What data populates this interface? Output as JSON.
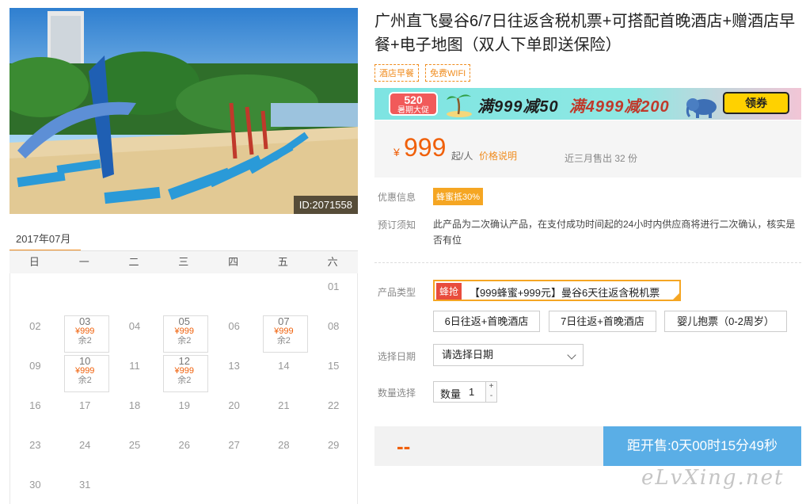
{
  "photo": {
    "id_label": "ID:2071558"
  },
  "calendar": {
    "month": "2017年07月",
    "weekdays": [
      "日",
      "一",
      "二",
      "三",
      "四",
      "五",
      "六"
    ],
    "lead_blanks": 6,
    "days": [
      {
        "d": "01"
      },
      {
        "d": "02"
      },
      {
        "d": "03",
        "price": "¥999",
        "remain": "余2"
      },
      {
        "d": "04"
      },
      {
        "d": "05",
        "price": "¥999",
        "remain": "余2"
      },
      {
        "d": "06"
      },
      {
        "d": "07",
        "price": "¥999",
        "remain": "余2"
      },
      {
        "d": "08"
      },
      {
        "d": "09"
      },
      {
        "d": "10",
        "price": "¥999",
        "remain": "余2"
      },
      {
        "d": "11"
      },
      {
        "d": "12",
        "price": "¥999",
        "remain": "余2"
      },
      {
        "d": "13"
      },
      {
        "d": "14"
      },
      {
        "d": "15"
      },
      {
        "d": "16"
      },
      {
        "d": "17"
      },
      {
        "d": "18"
      },
      {
        "d": "19"
      },
      {
        "d": "20"
      },
      {
        "d": "21"
      },
      {
        "d": "22"
      },
      {
        "d": "23"
      },
      {
        "d": "24"
      },
      {
        "d": "25"
      },
      {
        "d": "26"
      },
      {
        "d": "27"
      },
      {
        "d": "28"
      },
      {
        "d": "29"
      },
      {
        "d": "30"
      },
      {
        "d": "31"
      }
    ]
  },
  "product": {
    "title": "广州直飞曼谷6/7日往返含税机票+可搭配首晚酒店+赠酒店早餐+电子地图（双人下单即送保险）",
    "tags": [
      "酒店早餐",
      "免费WIFI"
    ]
  },
  "banner": {
    "badge_top": "520",
    "badge_bottom": "暑期大促",
    "offer_text_1": "满999减50",
    "offer_text_2": "满4999减200",
    "coupon_label": "领券",
    "colors": {
      "bg_start": "#7de4e2",
      "bg_end": "#f2c5d6",
      "coupon": "#ffd100"
    }
  },
  "price": {
    "currency": "¥",
    "value": "999",
    "unit": "起/人",
    "explain_link": "价格说明",
    "sold": "近三月售出 32 份"
  },
  "discount": {
    "label": "优惠信息",
    "tag": "蜂蜜抵30%"
  },
  "booking_notice": {
    "label": "预订须知",
    "text": "此产品为二次确认产品，在支付成功时间起的24小时内供应商将进行二次确认，核实是否有位"
  },
  "product_type": {
    "label": "产品类型",
    "selected_hot": "蜂抢",
    "selected": "【999蜂蜜+999元】曼谷6天往返含税机票",
    "options": [
      "6日往返+首晚酒店",
      "7日往返+首晚酒店",
      "婴儿抱票（0-2周岁）"
    ]
  },
  "date": {
    "label": "选择日期",
    "placeholder": "请选择日期"
  },
  "quantity": {
    "label": "数量选择",
    "inner_label": "数量",
    "value": "1",
    "plus": "+",
    "minus": "-"
  },
  "checkout": {
    "price_placeholder": "--",
    "countdown": "距开售:0天00时15分49秒"
  },
  "watermark": "eLvXing.net",
  "colors": {
    "accent": "#f0600a",
    "orange": "#f08c1e",
    "button": "#5aaee6"
  }
}
